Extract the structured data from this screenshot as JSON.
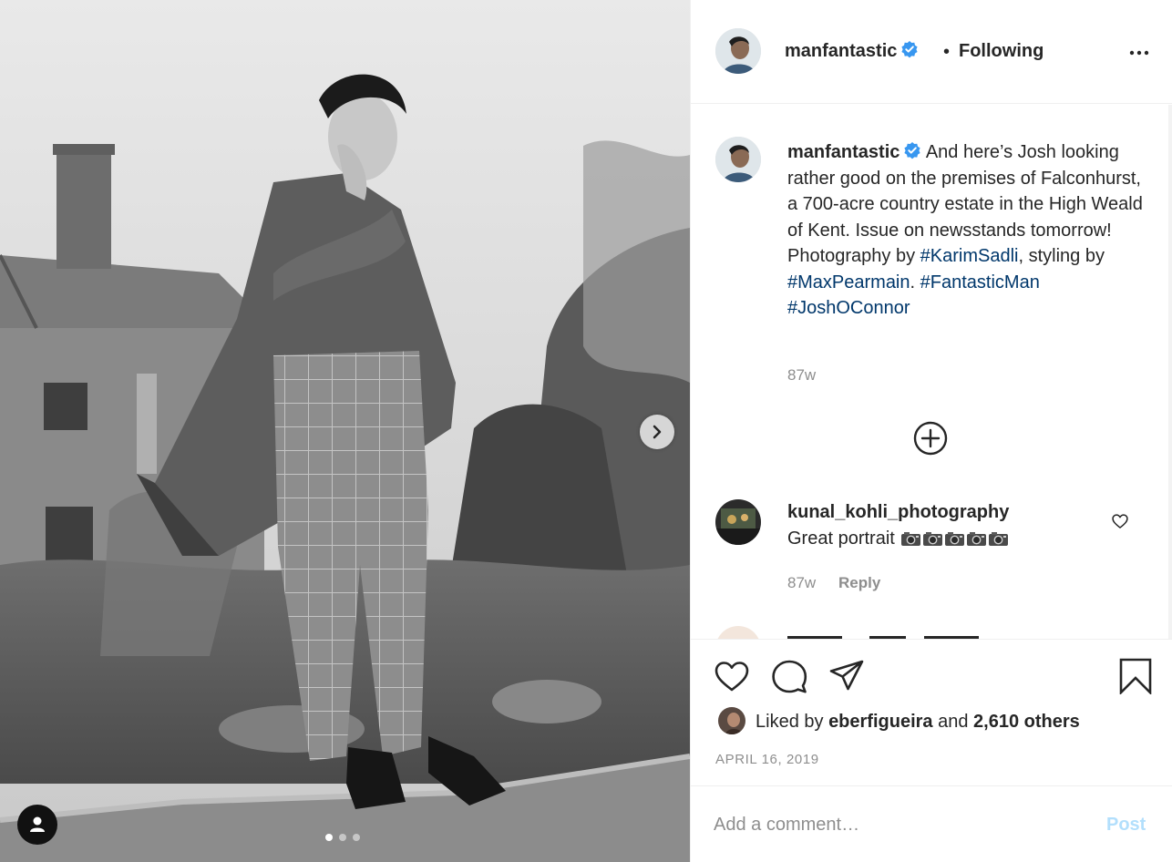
{
  "photo": {
    "alt_icons": {
      "next": "chevron-right-icon",
      "tags": "user-tag-icon"
    },
    "carousel": {
      "count": 3,
      "active_index": 0
    }
  },
  "header": {
    "username": "manfantastic",
    "verified": true,
    "separator": "•",
    "follow_state": "Following",
    "more_icon": "more-horizontal-icon"
  },
  "caption": {
    "username": "manfantastic",
    "text_parts": [
      "And here’s Josh looking rather good on the premises of Falconhurst, a 700-acre country estate in the High Weald of Kent. Issue on newsstands tomorrow! Photography by ",
      ", styling by ",
      ". ",
      " "
    ],
    "hashtags": [
      "#KarimSadli",
      "#MaxPearmain",
      "#FantasticMan",
      "#JoshOConnor"
    ],
    "age": "87w"
  },
  "load_more_icon": "plus-circle-icon",
  "comments": [
    {
      "username": "kunal_kohli_photography",
      "text": "Great portrait",
      "emoji_icons": [
        "camera-icon",
        "camera-icon",
        "camera-icon",
        "camera-icon",
        "camera-icon"
      ],
      "age": "87w",
      "reply_label": "Reply"
    }
  ],
  "actions": {
    "icons": [
      "heart-icon",
      "comment-icon",
      "share-icon",
      "bookmark-icon"
    ],
    "liked_by_prefix": "Liked by",
    "liked_by_user": "eberfigueira",
    "liked_by_and": "and",
    "liked_by_others": "2,610 others",
    "date": "APRIL 16, 2019"
  },
  "add_comment": {
    "placeholder": "Add a comment…",
    "post_label": "Post"
  },
  "colors": {
    "text": "#262626",
    "muted": "#8e8e8e",
    "hashtag": "#00376b",
    "verified": "#3897f0",
    "post_disabled": "#b2dffc",
    "divider": "#efefef"
  }
}
